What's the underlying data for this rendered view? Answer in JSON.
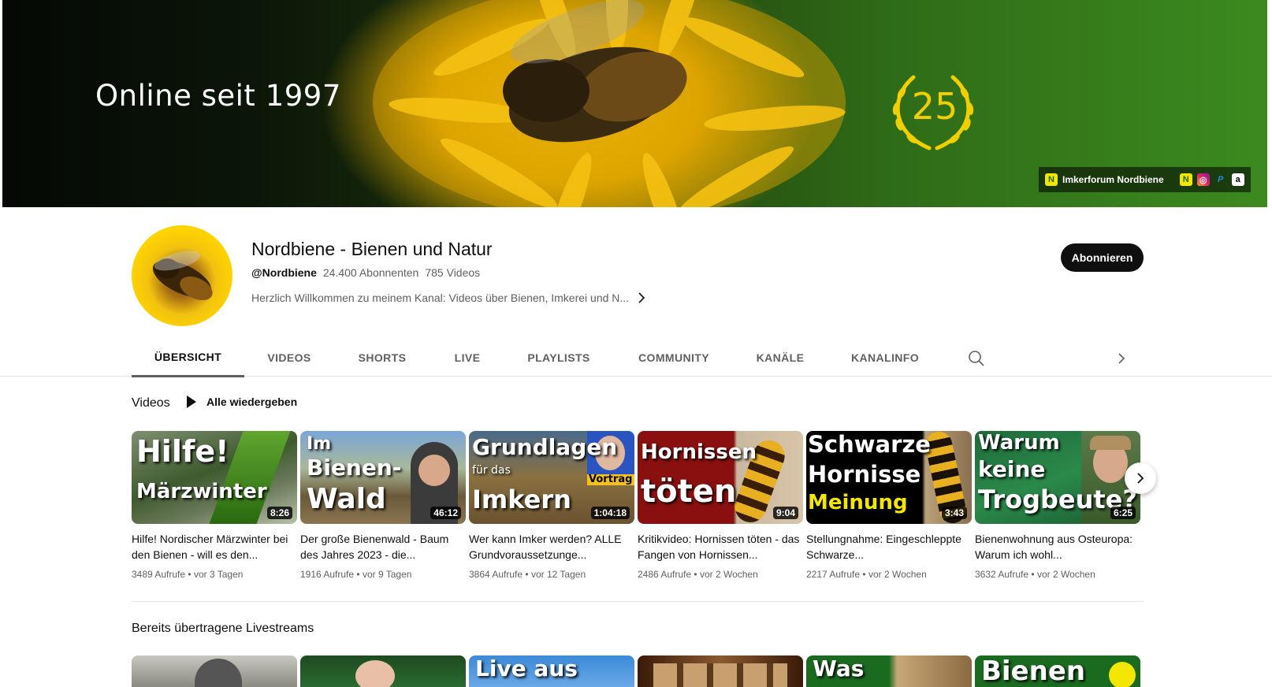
{
  "banner": {
    "title": "Online seit 1997",
    "anniversary": "25",
    "links": {
      "main_label": "Imkerforum Nordbiene",
      "icons": [
        "nordbiene-icon",
        "nordbiene-icon",
        "instagram-icon",
        "paypal-icon",
        "amazon-icon"
      ],
      "nb_glyph": "N",
      "ig_glyph": "◎",
      "pp_glyph": "P",
      "am_glyph": "a"
    }
  },
  "channel": {
    "name": "Nordbiene - Bienen und Natur",
    "handle": "@Nordbiene",
    "subscribers": "24.400 Abonnenten",
    "videos": "785 Videos",
    "description": "Herzlich Willkommen zu meinem Kanal: Videos über Bienen, Imkerei und N...",
    "subscribe_label": "Abonnieren"
  },
  "tabs": [
    "ÜBERSICHT",
    "VIDEOS",
    "SHORTS",
    "LIVE",
    "PLAYLISTS",
    "COMMUNITY",
    "KANÄLE",
    "KANALINFO"
  ],
  "videos_section": {
    "title": "Videos",
    "play_all": "Alle wiedergeben",
    "items": [
      {
        "thumb_lines": [
          "Hilfe!",
          "Märzwinter"
        ],
        "duration": "8:26",
        "title": "Hilfe! Nordischer Märzwinter bei den Bienen - will es den...",
        "views": "3489 Aufrufe",
        "age": "vor 3 Tagen"
      },
      {
        "thumb_lines": [
          "Im",
          "Bienen-",
          "Wald"
        ],
        "duration": "46:12",
        "title": "Der große Bienenwald - Baum des Jahres 2023 - die...",
        "views": "1916 Aufrufe",
        "age": "vor 9 Tagen"
      },
      {
        "thumb_lines": [
          "Grundlagen",
          "für das",
          "Imkern",
          "Vortrag"
        ],
        "duration": "1:04:18",
        "title": "Wer kann Imker werden? ALLE Grundvoraussetzunge...",
        "views": "3864 Aufrufe",
        "age": "vor 12 Tagen"
      },
      {
        "thumb_lines": [
          "Hornissen",
          "töten"
        ],
        "duration": "9:04",
        "title": "Kritikvideo: Hornissen töten - das Fangen von Hornissen...",
        "views": "2486 Aufrufe",
        "age": "vor 2 Wochen"
      },
      {
        "thumb_lines": [
          "Schwarze",
          "Hornisse",
          "Meinung"
        ],
        "duration": "3:43",
        "title": "Stellungnahme: Eingeschleppte Schwarze...",
        "views": "2217 Aufrufe",
        "age": "vor 2 Wochen"
      },
      {
        "thumb_lines": [
          "Warum",
          "keine",
          "Trogbeute?"
        ],
        "duration": "6:25",
        "title": "Bienenwohnung aus Osteuropa: Warum ich wohl...",
        "views": "3632 Aufrufe",
        "age": "vor 2 Wochen"
      }
    ],
    "separator": "•"
  },
  "live_section": {
    "title": "Bereits übertragene Livestreams",
    "items": [
      {
        "thumb_text": ""
      },
      {
        "thumb_text": ""
      },
      {
        "thumb_text": "Live aus"
      },
      {
        "thumb_text": ""
      },
      {
        "thumb_text": "Was"
      },
      {
        "thumb_text": "Bienen"
      }
    ]
  }
}
